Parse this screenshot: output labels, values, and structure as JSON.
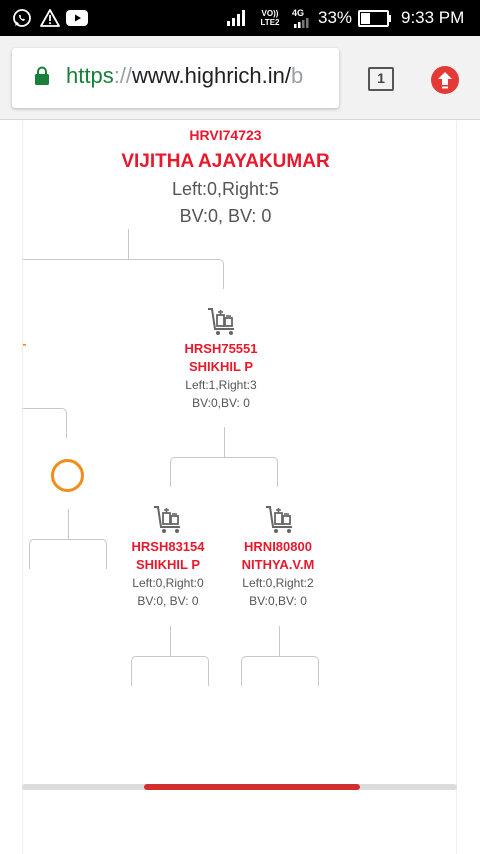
{
  "status_bar": {
    "battery_percent": "33%",
    "time": "9:33 PM",
    "volte_label": "VO)) LTE2",
    "network_label": "4G"
  },
  "browser": {
    "url_scheme": "https",
    "url_separator": "://",
    "url_host": "www.highrich.in/",
    "url_tail": "b",
    "tab_count": "1"
  },
  "tree": {
    "root": {
      "id": "HRVI74723",
      "name": "VIJITHA AJAYAKUMAR",
      "lr": "Left:0,Right:5",
      "bv": "BV:0, BV: 0"
    },
    "left_stub": "T",
    "right_child": {
      "id": "HRSH75551",
      "name": "SHIKHIL P",
      "lr": "Left:1,Right:3",
      "bv": "BV:0,BV: 0"
    },
    "grandchildren": [
      {
        "id": "HRSH83154",
        "name": "SHIKHIL P",
        "lr": "Left:0,Right:0",
        "bv": "BV:0, BV: 0"
      },
      {
        "id": "HRNI80800",
        "name": "NITHYA.V.M",
        "lr": "Left:0,Right:2",
        "bv": "BV:0,BV: 0"
      }
    ]
  },
  "scrollbar": {
    "thumb_color": "#d32f2f"
  },
  "colors": {
    "accent_red": "#e8192c",
    "orange": "#f28c1a"
  },
  "icons": [
    "whatsapp-icon",
    "warning-icon",
    "youtube-icon",
    "signal-icon",
    "battery-icon",
    "lock-icon",
    "tabs-icon",
    "update-icon",
    "cart-icon"
  ]
}
